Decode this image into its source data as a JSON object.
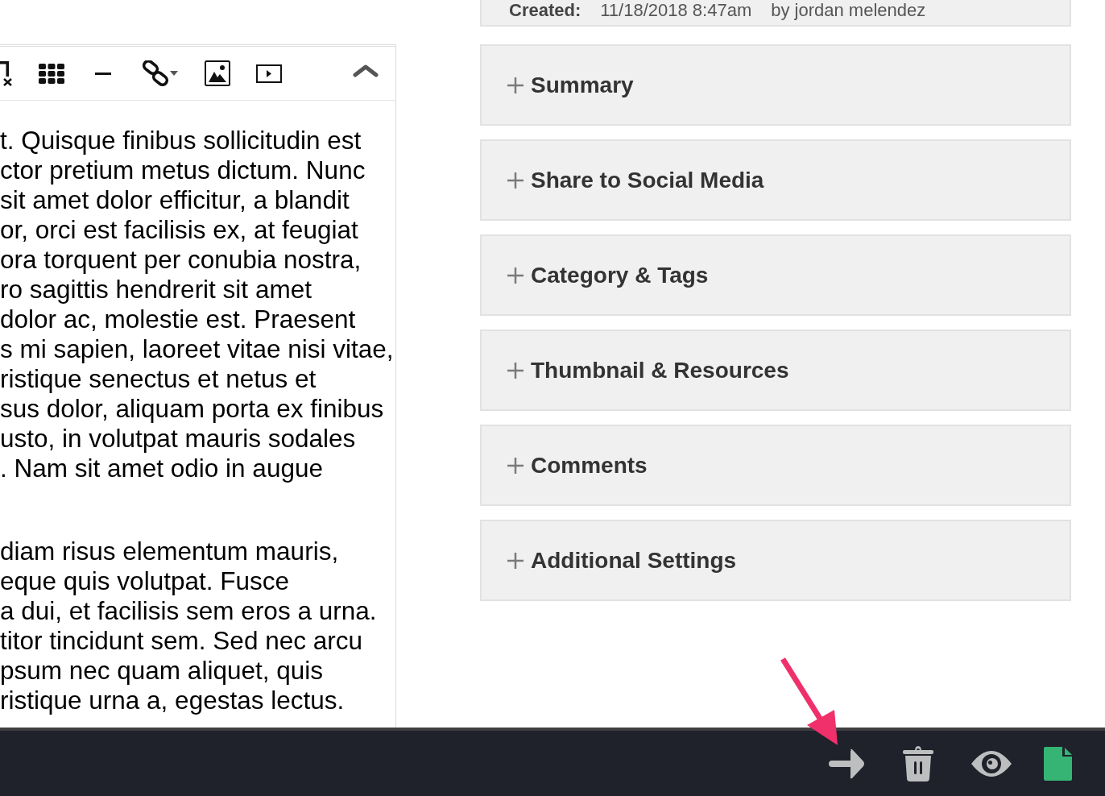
{
  "record_meta": {
    "label": "Created:",
    "date": "11/18/2018 8:47am",
    "author": "by jordan melendez"
  },
  "editor": {
    "paragraphs": [
      [
        "t. Quisque finibus sollicitudin est",
        "ctor pretium metus dictum. Nunc",
        "sit amet dolor efficitur, a blandit",
        "or, orci est facilisis ex, at feugiat",
        "ora torquent per conubia nostra,",
        "ro sagittis hendrerit sit amet",
        "dolor ac, molestie est. Praesent",
        "s mi sapien, laoreet vitae nisi vitae,",
        "ristique senectus et netus et",
        "sus dolor, aliquam porta ex finibus",
        "usto, in volutpat mauris sodales",
        ". Nam sit amet odio in augue"
      ],
      [
        "diam risus elementum mauris,",
        "eque quis volutpat. Fusce",
        "a dui, et facilisis sem eros a urna.",
        "titor tincidunt sem. Sed nec arcu",
        "psum nec quam aliquet, quis",
        "ristique urna a, egestas lectus."
      ]
    ]
  },
  "sections": [
    {
      "title": "Summary",
      "expanded": false
    },
    {
      "title": "Share to Social Media",
      "expanded": false
    },
    {
      "title": "Category & Tags",
      "expanded": false
    },
    {
      "title": "Thumbnail & Resources",
      "expanded": false
    },
    {
      "title": "Comments",
      "expanded": false
    },
    {
      "title": "Additional Settings",
      "expanded": false
    }
  ]
}
